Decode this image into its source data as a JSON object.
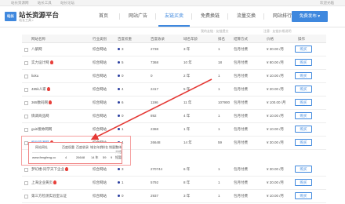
{
  "topbar": {
    "links": [
      "站长资源网",
      "站长工具",
      "站长论坛"
    ],
    "right": "欢迎光临"
  },
  "header": {
    "logo_badge": "站长",
    "logo_title": "站长资源平台",
    "logo_sub": "站长工具 •",
    "nav": [
      "首页",
      "网站广告",
      "友链买卖",
      "免费换链",
      "流量交换",
      "网站排行"
    ],
    "active_nav": "友链买卖",
    "publish_button": "免费发布 ▾"
  },
  "subrow": {
    "hint": "我的友链 · 友链提交",
    "tip": "注意 · 友链价格说明"
  },
  "table": {
    "headers": [
      "网站名称",
      "行业类别",
      "百度权重",
      "百度收录",
      "域名年龄",
      "排名",
      "结算方式",
      "价格",
      "操作"
    ],
    "rows": [
      {
        "name": "八紫网",
        "hot": false,
        "category": "综合网站",
        "weight": "3",
        "index": "2738",
        "age": "3 年",
        "rank": "1",
        "settle": "包月付费",
        "price": "¥ 30.00 /月",
        "action": "购买"
      },
      {
        "name": "实力设计网",
        "hot": true,
        "category": "综合网站",
        "weight": "5",
        "index": "7368",
        "age": "10 年",
        "rank": "18",
        "settle": "包月付费",
        "price": "¥ 80.00 /月",
        "action": "购买"
      },
      {
        "name": "lioku",
        "hot": false,
        "category": "综合网站",
        "weight": "0",
        "index": "0",
        "age": "2 年",
        "rank": "1",
        "settle": "包月付费",
        "price": "¥ 10.00 /月",
        "action": "购买"
      },
      {
        "name": "485k人家",
        "hot": true,
        "category": "综合网站",
        "weight": "4",
        "index": "2417",
        "age": "5 年",
        "rank": "1",
        "settle": "包月付费",
        "price": "¥ 20.00 /月",
        "action": "购买"
      },
      {
        "name": "365数码网",
        "hot": true,
        "category": "综合网站",
        "weight": "6",
        "index": "1196",
        "age": "11 年",
        "rank": "107900",
        "settle": "包月付费",
        "price": "¥ 100.00 /月",
        "action": "购买"
      },
      {
        "name": "情调商品网",
        "hot": false,
        "category": "综合网站",
        "weight": "0",
        "index": "892",
        "age": "4 年",
        "rank": "1",
        "settle": "包月付费",
        "price": "¥ 10.00 /月",
        "action": "购买"
      },
      {
        "name": "guiti傻帅网网",
        "hot": false,
        "category": "综合网站",
        "weight": "1",
        "index": "2368",
        "age": "1 年",
        "rank": "1",
        "settle": "包月付费",
        "price": "¥ 10.00 /月",
        "action": "购买"
      },
      {
        "name": "枫树资源网",
        "hot": true,
        "category": "综合网站",
        "weight": "4",
        "index": "26648",
        "age": "14 年",
        "rank": "59",
        "settle": "包月付费",
        "price": "¥ 30.00 /月",
        "action": "购买"
      },
      {
        "name": "",
        "hot": false,
        "category": "",
        "weight": "",
        "index": "",
        "age": "",
        "rank": "",
        "settle": "",
        "price": "",
        "action": ""
      },
      {
        "name": "梦幻楼-同学天下企业",
        "hot": true,
        "category": "综合网站",
        "weight": "3",
        "index": "270744",
        "age": "6 年",
        "rank": "1",
        "settle": "包月付费",
        "price": "¥ 30.00 /月",
        "action": "购买"
      },
      {
        "name": "上海企业黄页",
        "hot": true,
        "category": "综合网站",
        "weight": "1",
        "index": "5792",
        "age": "8 年",
        "rank": "1",
        "settle": "包月付费",
        "price": "¥ 20.00 /月",
        "action": "购买"
      },
      {
        "name": "第三方检测实验室认证",
        "hot": false,
        "category": "综合网站",
        "weight": "0",
        "index": "2937",
        "age": "3 年",
        "rank": "1",
        "settle": "包月付费",
        "price": "¥ 10.00 /月",
        "action": "购买"
      }
    ]
  },
  "popup": {
    "headers": [
      "网站网址",
      "百度权重",
      "百度收录",
      "域名年龄",
      "排名",
      "销量",
      "整体介绍"
    ],
    "values": [
      "www.fengfeng.cc",
      "4",
      "26648",
      "14 年",
      "59",
      "9",
      "短暂"
    ]
  },
  "colors": {
    "accent": "#3f88de",
    "hot": "#e8403b",
    "annotation": "#e53935"
  }
}
